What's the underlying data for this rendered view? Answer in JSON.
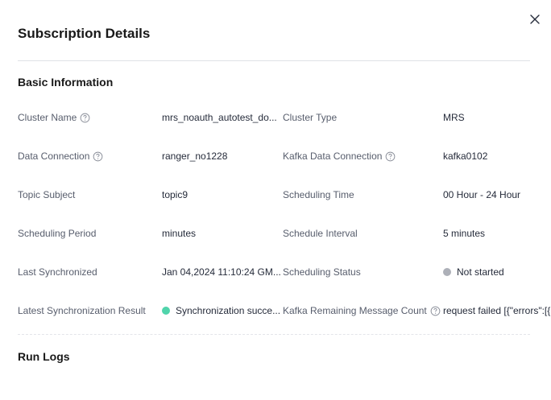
{
  "dialog": {
    "title": "Subscription Details",
    "close_icon": "close-icon"
  },
  "basic": {
    "heading": "Basic Information",
    "rows": [
      {
        "label_left": "Cluster Name",
        "value_left": "mrs_noauth_autotest_do...",
        "label_right": "Cluster Type",
        "value_right": "MRS"
      },
      {
        "label_left": "Data Connection",
        "value_left": "ranger_no1228",
        "label_right": "Kafka Data Connection",
        "value_right": "kafka0102"
      },
      {
        "label_left": "Topic Subject",
        "value_left": "topic9",
        "label_right": "Scheduling Time",
        "value_right": "00 Hour - 24 Hour"
      },
      {
        "label_left": "Scheduling Period",
        "value_left": "minutes",
        "label_right": "Schedule Interval",
        "value_right": "5 minutes"
      },
      {
        "label_left": "Last Synchronized",
        "value_left": "Jan 04,2024 11:10:24 GM...",
        "label_right": "Scheduling Status",
        "value_right": "Not started",
        "status_color": "#adb0b8"
      },
      {
        "label_left": "Latest Synchronization Result",
        "value_left": "Synchronization succe...",
        "label_right": "Kafka Remaining Message Count",
        "value_right": "request failed [{\"errors\":[{",
        "result_color": "#50d4ab"
      }
    ]
  },
  "logs": {
    "heading": "Run Logs"
  },
  "colors": {
    "title": "#191919",
    "label": "#575d6c",
    "value": "#252b3a",
    "divider": "#dfe1e6"
  }
}
